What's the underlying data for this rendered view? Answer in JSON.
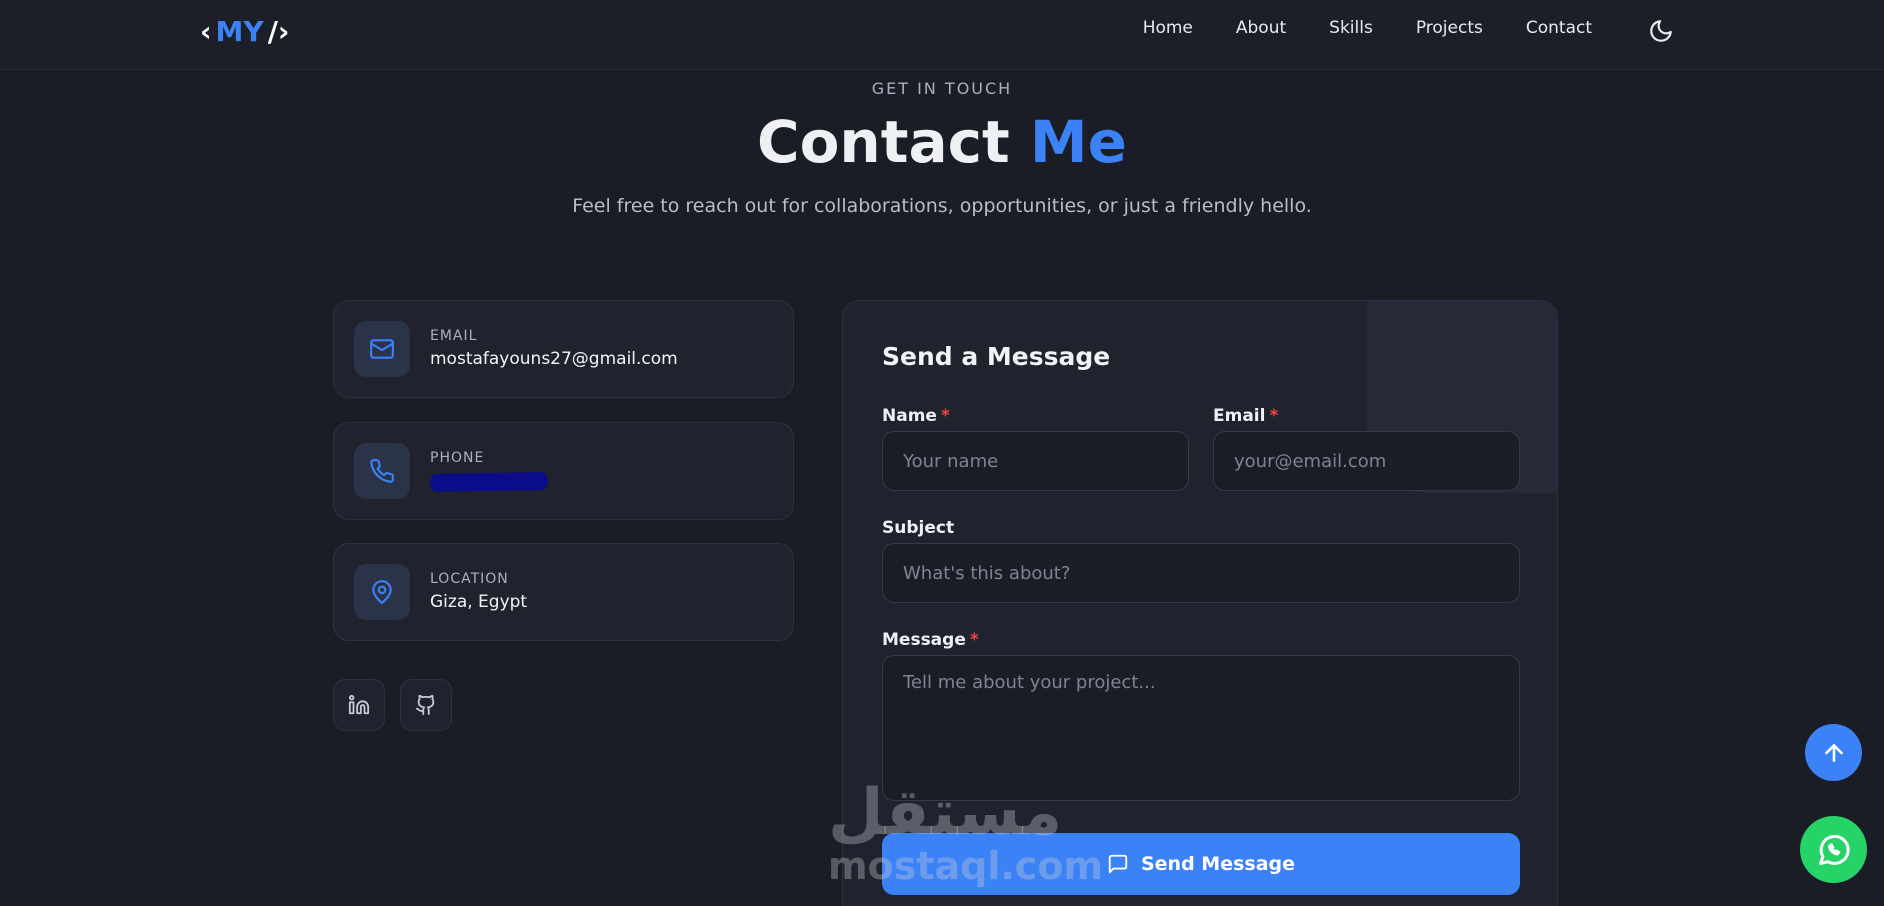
{
  "nav": {
    "logo": {
      "open": "‹",
      "text": "MY",
      "close": "/›"
    },
    "links": [
      "Home",
      "About",
      "Skills",
      "Projects",
      "Contact"
    ],
    "theme_icon": "moon-icon"
  },
  "header": {
    "eyebrow": "GET IN TOUCH",
    "title_main": "Contact",
    "title_accent": "Me",
    "subtitle": "Feel free to reach out for collaborations, opportunities, or just a friendly hello."
  },
  "info": [
    {
      "icon": "mail-icon",
      "label": "EMAIL",
      "value": "mostafayouns27@gmail.com"
    },
    {
      "icon": "phone-icon",
      "label": "PHONE",
      "value": ""
    },
    {
      "icon": "map-pin-icon",
      "label": "LOCATION",
      "value": "Giza, Egypt"
    }
  ],
  "social": [
    {
      "icon": "linkedin-icon"
    },
    {
      "icon": "github-icon"
    }
  ],
  "form": {
    "title": "Send a Message",
    "name_label": "Name",
    "name_placeholder": "Your name",
    "email_label": "Email",
    "email_placeholder": "your@email.com",
    "subject_label": "Subject",
    "subject_placeholder": "What's this about?",
    "message_label": "Message",
    "message_placeholder": "Tell me about your project...",
    "required_mark": "*",
    "submit_label": "Send Message"
  },
  "watermark": {
    "arabic": "مستقل",
    "latin": "mostaql.com"
  },
  "colors": {
    "accent": "#3b82f6",
    "background": "#1a1d26",
    "card": "#20232d",
    "required": "#ef4444",
    "whatsapp": "#25d366"
  }
}
